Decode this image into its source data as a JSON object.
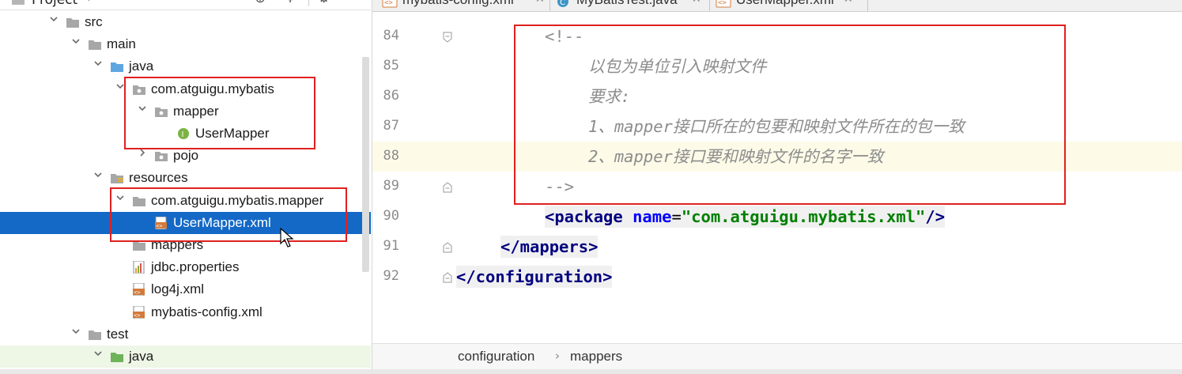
{
  "project_panel": {
    "title": "Project",
    "tree": [
      {
        "label": "src",
        "depth": 0,
        "expanded": true,
        "icon": "folder-icon"
      },
      {
        "label": "main",
        "depth": 1,
        "expanded": true,
        "icon": "folder-icon"
      },
      {
        "label": "java",
        "depth": 2,
        "expanded": true,
        "icon": "source-folder-icon"
      },
      {
        "label": "com.atguigu.mybatis",
        "depth": 3,
        "expanded": true,
        "icon": "package-icon"
      },
      {
        "label": "mapper",
        "depth": 4,
        "expanded": true,
        "icon": "package-icon"
      },
      {
        "label": "UserMapper",
        "depth": 5,
        "expanded": null,
        "icon": "interface-icon"
      },
      {
        "label": "pojo",
        "depth": 4,
        "expanded": false,
        "icon": "package-icon"
      },
      {
        "label": "resources",
        "depth": 2,
        "expanded": true,
        "icon": "resources-folder-icon"
      },
      {
        "label": "com.atguigu.mybatis.mapper",
        "depth": 3,
        "expanded": true,
        "icon": "folder-icon"
      },
      {
        "label": "UserMapper.xml",
        "depth": 4,
        "expanded": null,
        "icon": "xml-file-icon",
        "selected": true
      },
      {
        "label": "mappers",
        "depth": 3,
        "expanded": null,
        "icon": "folder-icon"
      },
      {
        "label": "jdbc.properties",
        "depth": 3,
        "expanded": null,
        "icon": "properties-file-icon"
      },
      {
        "label": "log4j.xml",
        "depth": 3,
        "expanded": null,
        "icon": "xml-file-icon"
      },
      {
        "label": "mybatis-config.xml",
        "depth": 3,
        "expanded": null,
        "icon": "xml-file-icon"
      },
      {
        "label": "test",
        "depth": 1,
        "expanded": true,
        "icon": "folder-icon"
      },
      {
        "label": "java",
        "depth": 2,
        "expanded": true,
        "icon": "test-source-folder-icon"
      }
    ]
  },
  "editor": {
    "tabs": [
      {
        "label": "mybatis-config.xml",
        "icon": "xml-file-icon",
        "active": true
      },
      {
        "label": "MyBatisTest.java",
        "icon": "java-class-icon",
        "active": false
      },
      {
        "label": "UserMapper.xml",
        "icon": "xml-file-icon",
        "active": false
      }
    ],
    "lines": [
      {
        "num": "84",
        "text": "<!--"
      },
      {
        "num": "85",
        "text": "以包为单位引入映射文件"
      },
      {
        "num": "86",
        "text": "要求:"
      },
      {
        "num": "87",
        "text": "1、mapper接口所在的包要和映射文件所在的包一致"
      },
      {
        "num": "88",
        "text": "2、mapper接口要和映射文件的名字一致"
      },
      {
        "num": "89",
        "text": "-->"
      },
      {
        "num": "90",
        "tag_open": "<package",
        "attr": "name",
        "eq": "=",
        "value": "\"com.atguigu.mybatis.xml\"",
        "tag_close": "/>"
      },
      {
        "num": "91",
        "text": "</mappers>"
      },
      {
        "num": "92",
        "text": "</configuration>"
      }
    ],
    "breadcrumb": [
      "configuration",
      "mappers"
    ],
    "breadcrumb_separator": "›"
  },
  "colors": {
    "selection": "#1469c7",
    "annotation_box": "#e02020",
    "comment": "#8c8c8c",
    "xml_tag": "#000080",
    "xml_attr": "#0000ff",
    "xml_value": "#008000"
  }
}
